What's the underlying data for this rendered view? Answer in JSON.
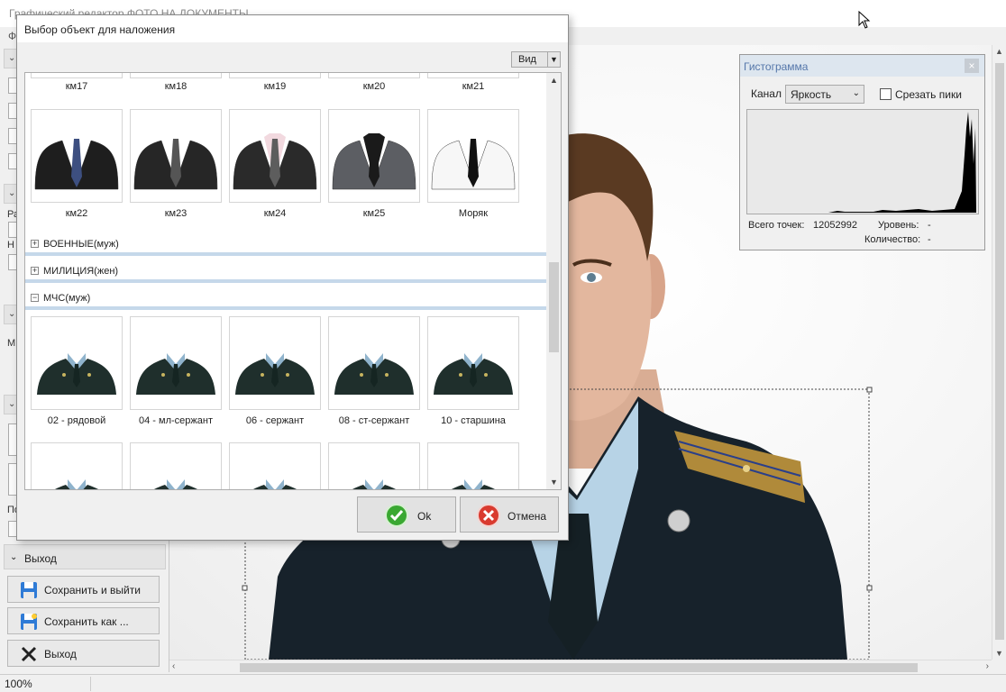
{
  "app": {
    "title": "Графический редактор ФОТО НА ДОКУМЕНТЫ",
    "menu_first": "Ф"
  },
  "left_panel": {
    "exit_section": "Выход",
    "chars": [
      "Ра",
      "Н",
      "М",
      "По"
    ],
    "buttons": [
      {
        "label": "Сохранить и выйти",
        "icon": "floppy-disk-icon"
      },
      {
        "label": "Сохранить как ...",
        "icon": "floppy-disk-icon"
      },
      {
        "label": "Выход",
        "icon": "close-x-icon"
      }
    ]
  },
  "status": {
    "zoom": "100%"
  },
  "histogram": {
    "title": "Гистограмма",
    "close": "×",
    "channel_label": "Канал",
    "channel_value": "Яркость",
    "clip_label": "Срезать пики",
    "clip_checked": false,
    "total_label": "Всего точек:",
    "total_value": "12052992",
    "levels_label": "Уровень:",
    "levels_value": "-",
    "count_label": "Количество:",
    "count_value": "-"
  },
  "dialog": {
    "title": "Выбор объект для наложения",
    "view_button": "Вид",
    "top_row_labels": [
      "км17",
      "км18",
      "км19",
      "км20",
      "км21"
    ],
    "row1": [
      {
        "label": "км22",
        "jacket": "#1e1e1e",
        "shirt": "#ffffff",
        "tie": "#3d4f80"
      },
      {
        "label": "км23",
        "jacket": "#262626",
        "shirt": "#ffffff",
        "tie": "#555555"
      },
      {
        "label": "км24",
        "jacket": "#2a2a2a",
        "shirt": "#f2d9df",
        "tie": "#5d5d5d"
      },
      {
        "label": "км25",
        "jacket": "#5c5e63",
        "shirt": "#1a1a1a",
        "tie": "#1a1a1a"
      },
      {
        "label": "Моряк",
        "jacket": "#f7f7f7",
        "shirt": "#ffffff",
        "tie": "#111111"
      }
    ],
    "categories": [
      {
        "label": "ВОЕННЫЕ(муж)",
        "sign": "+"
      },
      {
        "label": "МИЛИЦИЯ(жен)",
        "sign": "+"
      },
      {
        "label": "МЧС(муж)",
        "sign": "−"
      }
    ],
    "row2": [
      {
        "label": "02 - рядовой"
      },
      {
        "label": "04 - мл-сержант"
      },
      {
        "label": "06 - сержант"
      },
      {
        "label": "08 - ст-сержант"
      },
      {
        "label": "10 - старшина"
      }
    ],
    "uniform_colors": {
      "jacket": "#1f2f2c",
      "shirt": "#8fb3cc",
      "tie": "#152522"
    },
    "ok_label": "Ok",
    "cancel_label": "Отмена"
  }
}
